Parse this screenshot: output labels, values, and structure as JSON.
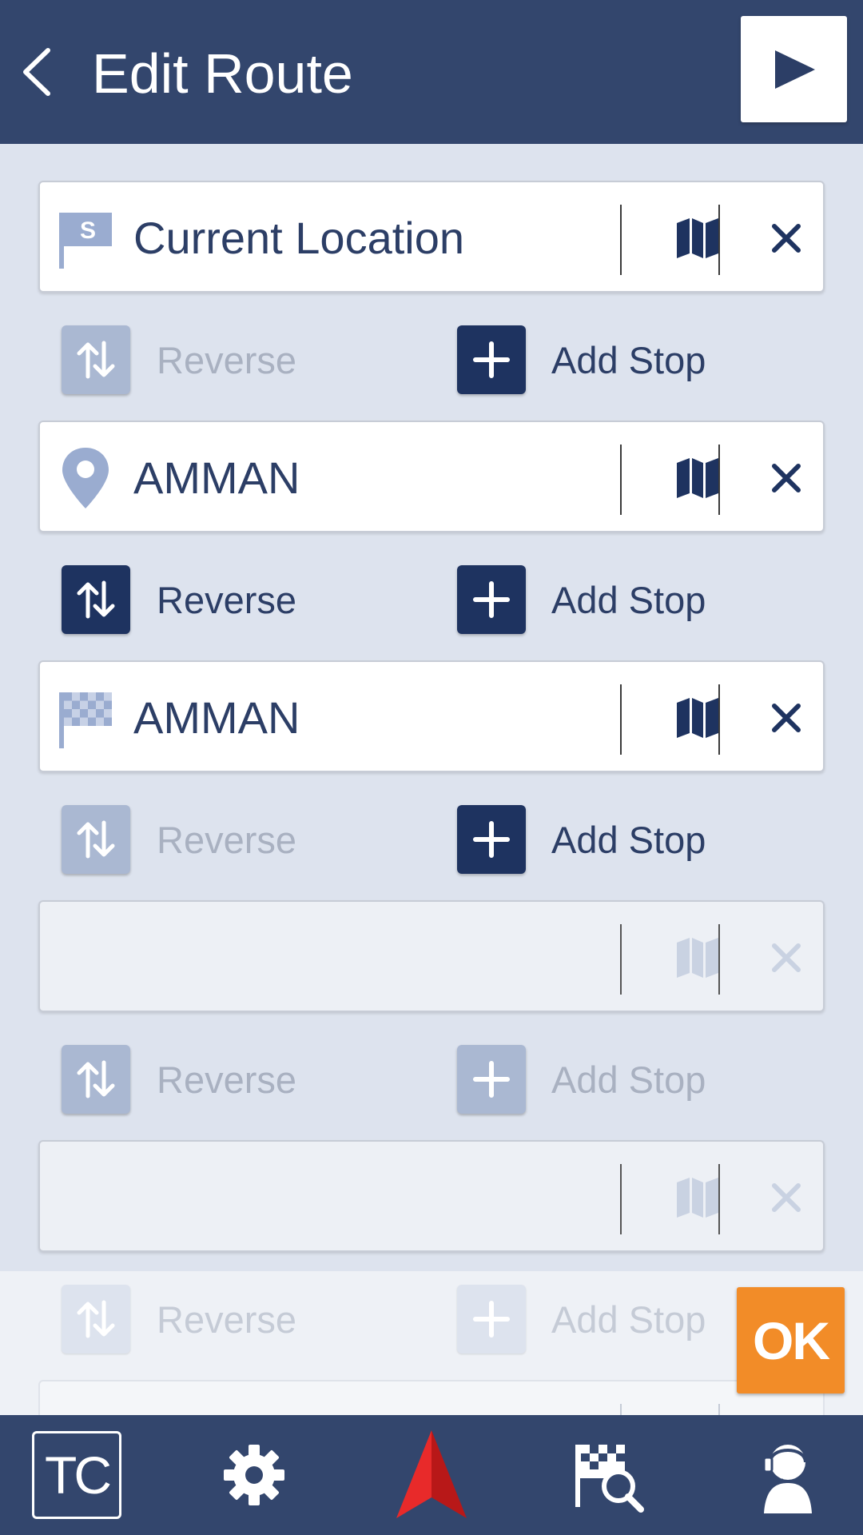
{
  "header": {
    "title": "Edit Route",
    "back_icon": "chevron-left-icon",
    "go_icon": "play-icon"
  },
  "waypoints": [
    {
      "text": "Current Location",
      "icon": "start-flag-icon",
      "state": "filled"
    },
    {
      "text": "AMMAN",
      "icon": "map-pin-icon",
      "state": "filled"
    },
    {
      "text": "AMMAN",
      "icon": "checkered-flag-icon",
      "state": "filled"
    },
    {
      "text": "",
      "icon": "",
      "state": "empty"
    },
    {
      "text": "",
      "icon": "",
      "state": "empty"
    },
    {
      "text": "",
      "icon": "",
      "state": "empty"
    }
  ],
  "actions": [
    {
      "reverse_label": "Reverse",
      "add_label": "Add Stop",
      "reverse_state": "disabled",
      "add_state": "active"
    },
    {
      "reverse_label": "Reverse",
      "add_label": "Add Stop",
      "reverse_state": "active",
      "add_state": "active"
    },
    {
      "reverse_label": "Reverse",
      "add_label": "Add Stop",
      "reverse_state": "disabled",
      "add_state": "active"
    },
    {
      "reverse_label": "Reverse",
      "add_label": "Add Stop",
      "reverse_state": "disabled",
      "add_state": "disabled"
    },
    {
      "reverse_label": "Reverse",
      "add_label": "Add Stop",
      "reverse_state": "faint",
      "add_state": "faint"
    }
  ],
  "ok_label": "OK",
  "bottom_nav": {
    "tc_label": "TC",
    "items": [
      "settings-gear-icon",
      "navigation-arrow-icon",
      "destination-search-icon",
      "voice-assistant-icon"
    ]
  },
  "colors": {
    "header_bg": "#33466d",
    "page_bg": "#dde3ee",
    "active_button": "#1e3360",
    "ok_orange": "#f28c28",
    "arrow_red": "#e02626"
  }
}
